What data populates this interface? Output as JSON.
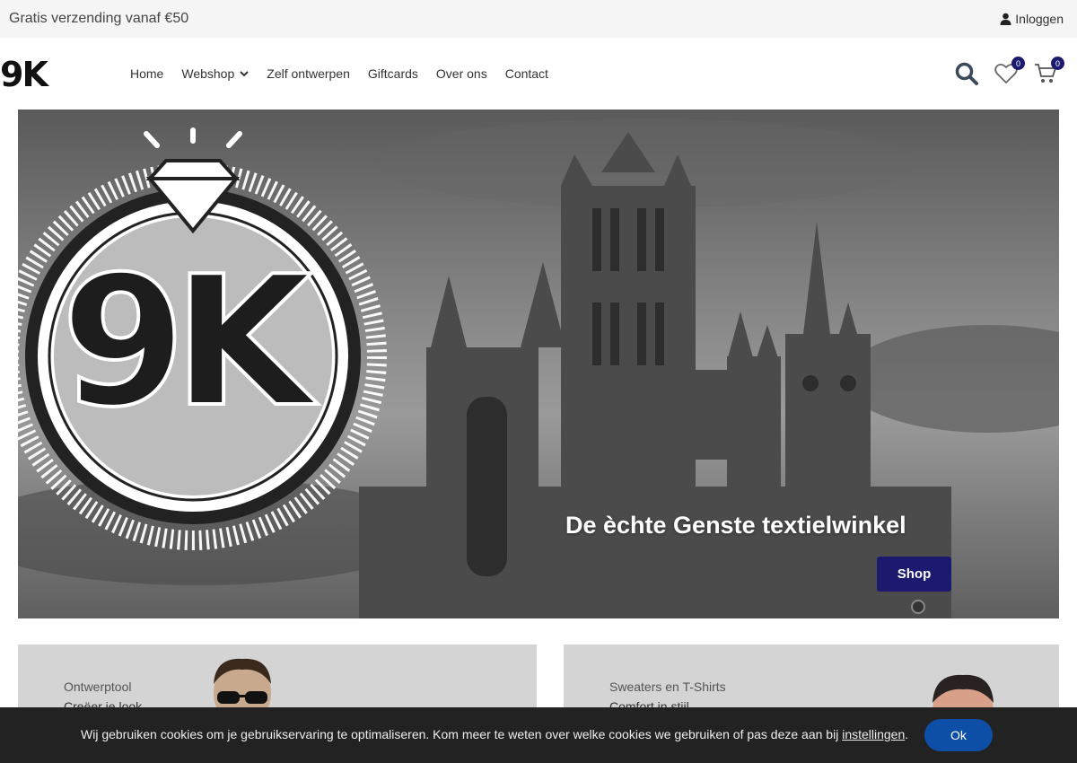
{
  "topbar": {
    "promo": "Gratis verzending vanaf €50",
    "login": "Inloggen"
  },
  "logo": {
    "text": "9K"
  },
  "nav": {
    "items": [
      "Home",
      "Webshop",
      "Zelf ontwerpen",
      "Giftcards",
      "Over ons",
      "Contact"
    ]
  },
  "icons": {
    "wishlist_count": "0",
    "cart_count": "0"
  },
  "hero": {
    "title": "De èchte Genste textielwinkel",
    "button": "Shop",
    "logo_text": "9K"
  },
  "cards": [
    {
      "subtitle": "Ontwerptool",
      "tagline": "Creëer je look"
    },
    {
      "subtitle": "Sweaters en T-Shirts",
      "tagline": "Comfort in stijl"
    }
  ],
  "cookie": {
    "text": "Wij gebruiken cookies om je gebruikservaring te optimaliseren. Kom meer te weten over welke cookies we gebruiken of pas deze aan bij ",
    "link": "instellingen",
    "end": ".",
    "ok": "Ok"
  },
  "colors": {
    "brand": "#1b1a6e",
    "ok_button": "#0d4ea6"
  }
}
